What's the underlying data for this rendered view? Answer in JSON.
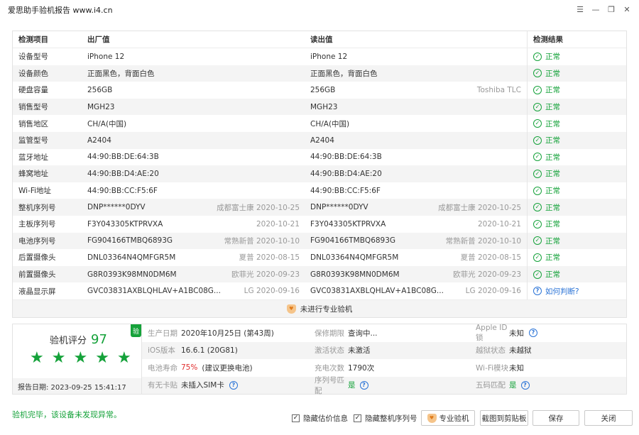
{
  "window": {
    "title": "爱思助手验机报告 www.i4.cn"
  },
  "table": {
    "headers": [
      "检测项目",
      "出厂值",
      "读出值",
      "检测结果"
    ],
    "rows": [
      {
        "item": "设备型号",
        "factory": "iPhone 12",
        "factory_note": "",
        "read": "iPhone 12",
        "read_note": "",
        "result": "正常",
        "result_type": "ok"
      },
      {
        "item": "设备颜色",
        "factory": "正面黑色，背面白色",
        "factory_note": "",
        "read": "正面黑色，背面白色",
        "read_note": "",
        "result": "正常",
        "result_type": "ok"
      },
      {
        "item": "硬盘容量",
        "factory": "256GB",
        "factory_note": "",
        "read": "256GB",
        "read_note": "Toshiba TLC",
        "result": "正常",
        "result_type": "ok"
      },
      {
        "item": "销售型号",
        "factory": "MGH23",
        "factory_note": "",
        "read": "MGH23",
        "read_note": "",
        "result": "正常",
        "result_type": "ok"
      },
      {
        "item": "销售地区",
        "factory": "CH/A(中国)",
        "factory_note": "",
        "read": "CH/A(中国)",
        "read_note": "",
        "result": "正常",
        "result_type": "ok"
      },
      {
        "item": "监管型号",
        "factory": "A2404",
        "factory_note": "",
        "read": "A2404",
        "read_note": "",
        "result": "正常",
        "result_type": "ok"
      },
      {
        "item": "蓝牙地址",
        "factory": "44:90:BB:DE:64:3B",
        "factory_note": "",
        "read": "44:90:BB:DE:64:3B",
        "read_note": "",
        "result": "正常",
        "result_type": "ok"
      },
      {
        "item": "蜂窝地址",
        "factory": "44:90:BB:D4:AE:20",
        "factory_note": "",
        "read": "44:90:BB:D4:AE:20",
        "read_note": "",
        "result": "正常",
        "result_type": "ok"
      },
      {
        "item": "Wi-Fi地址",
        "factory": "44:90:BB:CC:F5:6F",
        "factory_note": "",
        "read": "44:90:BB:CC:F5:6F",
        "read_note": "",
        "result": "正常",
        "result_type": "ok"
      },
      {
        "item": "整机序列号",
        "factory": "DNP******0DYV",
        "factory_note": "成都富士康 2020-10-25",
        "read": "DNP******0DYV",
        "read_note": "成都富士康 2020-10-25",
        "result": "正常",
        "result_type": "ok"
      },
      {
        "item": "主板序列号",
        "factory": "F3Y043305KTPRVXA",
        "factory_note": "2020-10-21",
        "read": "F3Y043305KTPRVXA",
        "read_note": "2020-10-21",
        "result": "正常",
        "result_type": "ok"
      },
      {
        "item": "电池序列号",
        "factory": "FG904166TMBQ6893G",
        "factory_note": "常熟新普 2020-10-10",
        "read": "FG904166TMBQ6893G",
        "read_note": "常熟新普 2020-10-10",
        "result": "正常",
        "result_type": "ok"
      },
      {
        "item": "后置摄像头",
        "factory": "DNL03364N4QMFGR5M",
        "factory_note": "夏普 2020-08-15",
        "read": "DNL03364N4QMFGR5M",
        "read_note": "夏普 2020-08-15",
        "result": "正常",
        "result_type": "ok"
      },
      {
        "item": "前置摄像头",
        "factory": "G8R0393K98MN0DM6M",
        "factory_note": "欧菲光 2020-09-23",
        "read": "G8R0393K98MN0DM6M",
        "read_note": "欧菲光 2020-09-23",
        "result": "正常",
        "result_type": "ok"
      },
      {
        "item": "液晶显示屏",
        "factory": "GVC03831AXBLQHLAV+A1BC08G...",
        "factory_note": "LG 2020-09-16",
        "read": "GVC03831AXBLQHLAV+A1BC08G...",
        "read_note": "LG 2020-09-16",
        "result": "如何判断?",
        "result_type": "link"
      }
    ],
    "pro_note": "未进行专业验机"
  },
  "summary": {
    "score_label": "验机评分",
    "score": "97",
    "stars": 5,
    "badge": "验",
    "report_date": "报告日期: 2023-09-25 15:41:17",
    "rows": [
      [
        {
          "label": "生产日期",
          "value": "2020年10月25日 (第43周)"
        },
        {
          "label": "保修期限",
          "value": "查询中..."
        },
        {
          "label": "Apple ID锁",
          "value": "未知",
          "help": true
        }
      ],
      [
        {
          "label": "iOS版本",
          "value": "16.6.1 (20G81)"
        },
        {
          "label": "激活状态",
          "value": "未激活"
        },
        {
          "label": "越狱状态",
          "value": "未越狱"
        }
      ],
      [
        {
          "label": "电池寿命",
          "value": "75%",
          "value_color": "red",
          "value2": "(建议更换电池)"
        },
        {
          "label": "充电次数",
          "value": "1790次"
        },
        {
          "label": "Wi-Fi模块",
          "value": "未知"
        }
      ],
      [
        {
          "label": "有无卡贴",
          "value": "未插入SIM卡",
          "help": true
        },
        {
          "label": "序列号匹配",
          "value": "是",
          "value_color": "green",
          "help": true
        },
        {
          "label": "五码匹配",
          "value": "是",
          "value_color": "green",
          "help": true
        }
      ]
    ]
  },
  "footer": {
    "status": "验机完毕，该设备未发现异常。",
    "hide_price": "隐藏估价信息",
    "hide_serial": "隐藏整机序列号",
    "pro_check": "专业验机",
    "screenshot": "截图到剪贴板",
    "save": "保存",
    "close": "关闭"
  }
}
